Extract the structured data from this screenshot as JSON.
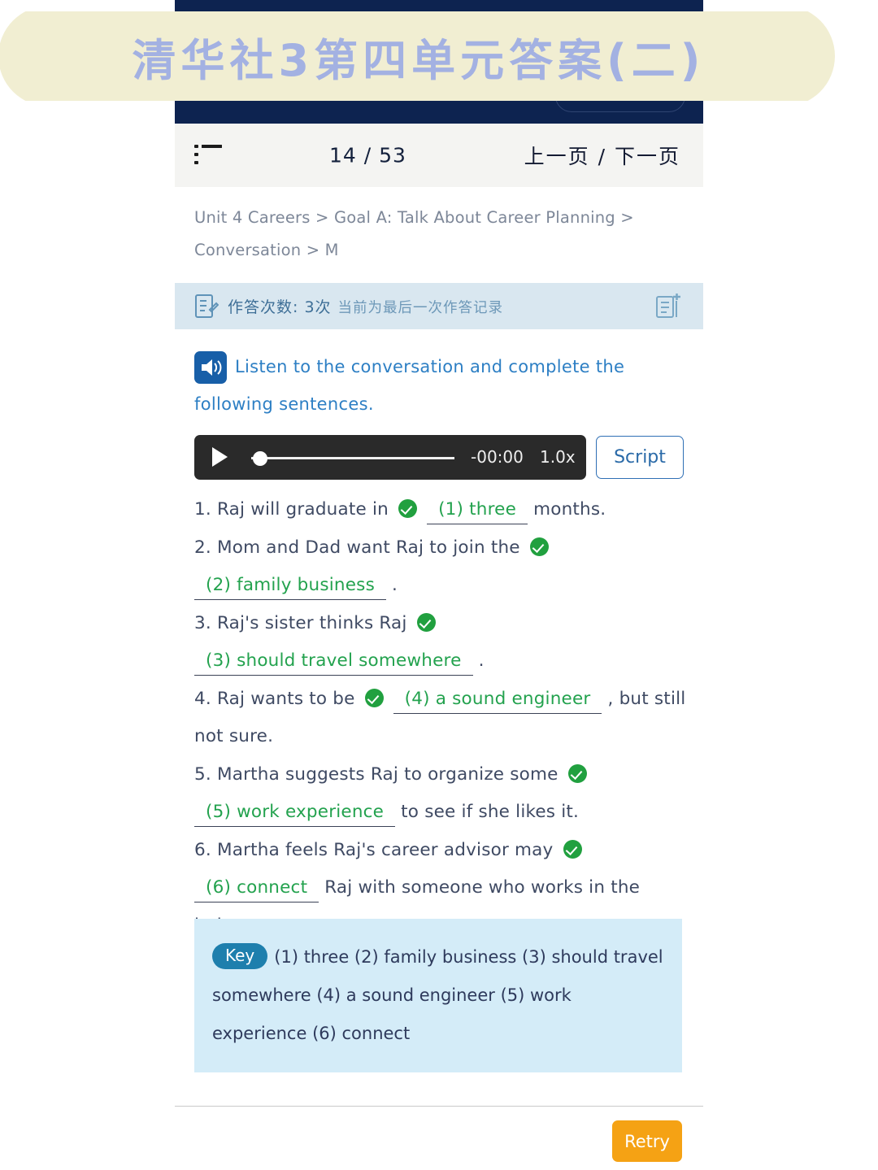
{
  "overlay_banner": {
    "title": "清华社3第四单元答案(二)",
    "bg_color": "#f1eed2",
    "text_color": "#a3b1e2"
  },
  "app_header": {
    "bg_color": "#0d2350"
  },
  "pager": {
    "menu_icon": "list-menu-icon",
    "page_count": "14 / 53",
    "nav_label": "上一页 / 下一页"
  },
  "breadcrumb": {
    "text": "Unit 4 Careers > Goal A: Talk About Career Planning > Conversation > M"
  },
  "attempt_bar": {
    "left_icon": "document-edit-icon",
    "main_text": "作答次数: 3次",
    "sub_text": "当前为最后一次作答记录",
    "right_icon": "add-note-icon",
    "bg_color": "#d9e7f0"
  },
  "instruction": {
    "speaker_icon": "speaker-icon",
    "text": "Listen to the conversation and complete the following sentences."
  },
  "audio_player": {
    "play_icon": "play-icon",
    "time": "-00:00",
    "rate": "1.0x",
    "script_label": "Script"
  },
  "questions": [
    {
      "number": "1.",
      "before": "Raj will graduate in",
      "answer": "(1) three",
      "after": "months."
    },
    {
      "number": "2.",
      "before": "Mom and Dad want Raj to join the",
      "answer": "(2) family business",
      "after": "."
    },
    {
      "number": "3.",
      "before": "Raj's sister thinks Raj",
      "answer": "(3) should travel somewhere",
      "after": "."
    },
    {
      "number": "4.",
      "before": "Raj wants to be",
      "answer": "(4) a sound engineer",
      "after": ", but still not sure."
    },
    {
      "number": "5.",
      "before": "Martha suggests Raj to organize some",
      "answer": "(5) work experience",
      "after": "to see if she likes it."
    },
    {
      "number": "6.",
      "before": "Martha feels Raj's career advisor may",
      "answer": "(6) connect",
      "after": "Raj with someone who works in the industry."
    }
  ],
  "key_panel": {
    "badge": "Key",
    "text": "(1) three  (2) family business  (3) should travel somewhere  (4) a sound engineer  (5) work experience  (6) connect",
    "bg_color": "#d4ecf8",
    "badge_color": "#1e7fad"
  },
  "footer": {
    "retry_label": "Retry",
    "retry_color": "#f5a214"
  }
}
